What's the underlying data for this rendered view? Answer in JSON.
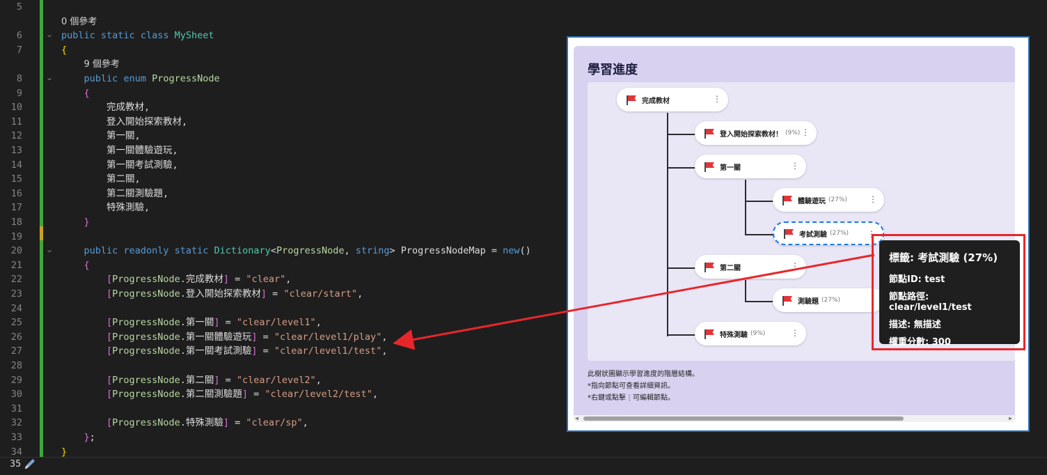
{
  "editor": {
    "lines": [
      {
        "n": "5",
        "parts": []
      },
      {
        "n": "",
        "parts": [
          {
            "c": "ref",
            "t": "0 個參考"
          }
        ]
      },
      {
        "n": "6",
        "fold": "v",
        "parts": [
          {
            "c": "kw",
            "t": "public"
          },
          {
            "c": "pl",
            "t": " "
          },
          {
            "c": "kw",
            "t": "static"
          },
          {
            "c": "pl",
            "t": " "
          },
          {
            "c": "kw",
            "t": "class"
          },
          {
            "c": "pl",
            "t": " "
          },
          {
            "c": "ty",
            "t": "MySheet"
          }
        ]
      },
      {
        "n": "7",
        "parts": [
          {
            "c": "bk",
            "t": "{"
          }
        ]
      },
      {
        "n": "",
        "parts": [
          {
            "c": "ws",
            "t": "    "
          },
          {
            "c": "ref",
            "t": "9 個參考"
          }
        ]
      },
      {
        "n": "8",
        "fold": "v",
        "parts": [
          {
            "c": "ws",
            "t": "    "
          },
          {
            "c": "kw",
            "t": "public"
          },
          {
            "c": "pl",
            "t": " "
          },
          {
            "c": "kw",
            "t": "enum"
          },
          {
            "c": "pl",
            "t": " "
          },
          {
            "c": "en",
            "t": "ProgressNode"
          }
        ]
      },
      {
        "n": "9",
        "parts": [
          {
            "c": "ws",
            "t": "    "
          },
          {
            "c": "pu",
            "t": "{"
          }
        ]
      },
      {
        "n": "10",
        "parts": [
          {
            "c": "ws",
            "t": "        "
          },
          {
            "c": "pl",
            "t": "完成教材,"
          }
        ]
      },
      {
        "n": "11",
        "parts": [
          {
            "c": "ws",
            "t": "        "
          },
          {
            "c": "pl",
            "t": "登入開始探索教材,"
          }
        ]
      },
      {
        "n": "12",
        "parts": [
          {
            "c": "ws",
            "t": "        "
          },
          {
            "c": "pl",
            "t": "第一關,"
          }
        ]
      },
      {
        "n": "13",
        "parts": [
          {
            "c": "ws",
            "t": "        "
          },
          {
            "c": "pl",
            "t": "第一關體驗遊玩,"
          }
        ]
      },
      {
        "n": "14",
        "parts": [
          {
            "c": "ws",
            "t": "        "
          },
          {
            "c": "pl",
            "t": "第一關考試測驗,"
          }
        ]
      },
      {
        "n": "15",
        "parts": [
          {
            "c": "ws",
            "t": "        "
          },
          {
            "c": "pl",
            "t": "第二關,"
          }
        ]
      },
      {
        "n": "16",
        "parts": [
          {
            "c": "ws",
            "t": "        "
          },
          {
            "c": "pl",
            "t": "第二關測驗題,"
          }
        ]
      },
      {
        "n": "17",
        "parts": [
          {
            "c": "ws",
            "t": "        "
          },
          {
            "c": "pl",
            "t": "特殊測驗,"
          }
        ]
      },
      {
        "n": "18",
        "parts": [
          {
            "c": "ws",
            "t": "    "
          },
          {
            "c": "pu",
            "t": "}"
          }
        ]
      },
      {
        "n": "19",
        "parts": []
      },
      {
        "n": "20",
        "fold": "v",
        "parts": [
          {
            "c": "ws",
            "t": "    "
          },
          {
            "c": "kw",
            "t": "public"
          },
          {
            "c": "pl",
            "t": " "
          },
          {
            "c": "kw",
            "t": "readonly"
          },
          {
            "c": "pl",
            "t": " "
          },
          {
            "c": "kw",
            "t": "static"
          },
          {
            "c": "pl",
            "t": " "
          },
          {
            "c": "ty",
            "t": "Dictionary"
          },
          {
            "c": "pl",
            "t": "<"
          },
          {
            "c": "en",
            "t": "ProgressNode"
          },
          {
            "c": "pl",
            "t": ", "
          },
          {
            "c": "kw",
            "t": "string"
          },
          {
            "c": "pl",
            "t": "> ProgressNodeMap = "
          },
          {
            "c": "kw",
            "t": "new"
          },
          {
            "c": "pl",
            "t": "()"
          }
        ]
      },
      {
        "n": "21",
        "parts": [
          {
            "c": "ws",
            "t": "    "
          },
          {
            "c": "pu",
            "t": "{"
          }
        ]
      },
      {
        "n": "22",
        "parts": [
          {
            "c": "ws",
            "t": "        "
          },
          {
            "c": "pu",
            "t": "["
          },
          {
            "c": "en",
            "t": "ProgressNode"
          },
          {
            "c": "pl",
            "t": ".完成教材"
          },
          {
            "c": "pu",
            "t": "]"
          },
          {
            "c": "pl",
            "t": " = "
          },
          {
            "c": "st",
            "t": "\"clear\""
          },
          {
            "c": "pl",
            "t": ","
          }
        ]
      },
      {
        "n": "23",
        "parts": [
          {
            "c": "ws",
            "t": "        "
          },
          {
            "c": "pu",
            "t": "["
          },
          {
            "c": "en",
            "t": "ProgressNode"
          },
          {
            "c": "pl",
            "t": ".登入開始探索教材"
          },
          {
            "c": "pu",
            "t": "]"
          },
          {
            "c": "pl",
            "t": " = "
          },
          {
            "c": "st",
            "t": "\"clear/start\""
          },
          {
            "c": "pl",
            "t": ","
          }
        ]
      },
      {
        "n": "24",
        "parts": []
      },
      {
        "n": "25",
        "parts": [
          {
            "c": "ws",
            "t": "        "
          },
          {
            "c": "pu",
            "t": "["
          },
          {
            "c": "en",
            "t": "ProgressNode"
          },
          {
            "c": "pl",
            "t": ".第一關"
          },
          {
            "c": "pu",
            "t": "]"
          },
          {
            "c": "pl",
            "t": " = "
          },
          {
            "c": "st",
            "t": "\"clear/level1\""
          },
          {
            "c": "pl",
            "t": ","
          }
        ]
      },
      {
        "n": "26",
        "parts": [
          {
            "c": "ws",
            "t": "        "
          },
          {
            "c": "pu",
            "t": "["
          },
          {
            "c": "en",
            "t": "ProgressNode"
          },
          {
            "c": "pl",
            "t": ".第一關體驗遊玩"
          },
          {
            "c": "pu",
            "t": "]"
          },
          {
            "c": "pl",
            "t": " = "
          },
          {
            "c": "st",
            "t": "\"clear/level1/play\""
          },
          {
            "c": "pl",
            "t": ","
          }
        ]
      },
      {
        "n": "27",
        "parts": [
          {
            "c": "ws",
            "t": "        "
          },
          {
            "c": "pu",
            "t": "["
          },
          {
            "c": "en",
            "t": "ProgressNode"
          },
          {
            "c": "pl",
            "t": ".第一關考試測驗"
          },
          {
            "c": "pu",
            "t": "]"
          },
          {
            "c": "pl",
            "t": " = "
          },
          {
            "c": "st",
            "t": "\"clear/level1/test\""
          },
          {
            "c": "pl",
            "t": ","
          }
        ]
      },
      {
        "n": "28",
        "parts": []
      },
      {
        "n": "29",
        "parts": [
          {
            "c": "ws",
            "t": "        "
          },
          {
            "c": "pu",
            "t": "["
          },
          {
            "c": "en",
            "t": "ProgressNode"
          },
          {
            "c": "pl",
            "t": ".第二關"
          },
          {
            "c": "pu",
            "t": "]"
          },
          {
            "c": "pl",
            "t": " = "
          },
          {
            "c": "st",
            "t": "\"clear/level2\""
          },
          {
            "c": "pl",
            "t": ","
          }
        ]
      },
      {
        "n": "30",
        "parts": [
          {
            "c": "ws",
            "t": "        "
          },
          {
            "c": "pu",
            "t": "["
          },
          {
            "c": "en",
            "t": "ProgressNode"
          },
          {
            "c": "pl",
            "t": ".第二關測驗題"
          },
          {
            "c": "pu",
            "t": "]"
          },
          {
            "c": "pl",
            "t": " = "
          },
          {
            "c": "st",
            "t": "\"clear/level2/test\""
          },
          {
            "c": "pl",
            "t": ","
          }
        ]
      },
      {
        "n": "31",
        "parts": []
      },
      {
        "n": "32",
        "parts": [
          {
            "c": "ws",
            "t": "        "
          },
          {
            "c": "pu",
            "t": "["
          },
          {
            "c": "en",
            "t": "ProgressNode"
          },
          {
            "c": "pl",
            "t": ".特殊測驗"
          },
          {
            "c": "pu",
            "t": "]"
          },
          {
            "c": "pl",
            "t": " = "
          },
          {
            "c": "st",
            "t": "\"clear/sp\""
          },
          {
            "c": "pl",
            "t": ","
          }
        ]
      },
      {
        "n": "33",
        "parts": [
          {
            "c": "ws",
            "t": "    "
          },
          {
            "c": "pu",
            "t": "}"
          },
          {
            "c": "pl",
            "t": ";"
          }
        ]
      },
      {
        "n": "34",
        "parts": [
          {
            "c": "bk",
            "t": "}"
          }
        ]
      }
    ],
    "last_line_number": "35"
  },
  "panel": {
    "title": "學習進度",
    "nodes": [
      {
        "label": "完成教材",
        "pct": ""
      },
      {
        "label": "登入開始探索教材！",
        "pct": "(9%)"
      },
      {
        "label": "第一關",
        "pct": ""
      },
      {
        "label": "體驗遊玩",
        "pct": "(27%)"
      },
      {
        "label": "考試測驗",
        "pct": "(27%)"
      },
      {
        "label": "第二關",
        "pct": ""
      },
      {
        "label": "測驗題",
        "pct": "(27%)"
      },
      {
        "label": "特殊測驗",
        "pct": "(9%)"
      }
    ],
    "kebab": "⋮",
    "notes": [
      "此樹狀圖顯示學習進度的階層結構。",
      "*指向節點可查看詳細資訊。",
      "*右鍵或點擊⋮可編輯節點。"
    ],
    "scroll_left": "◀",
    "scroll_right": "▶"
  },
  "tooltip": {
    "title": "標籤: 考試測驗 (27%)",
    "rows": [
      "節點ID: test",
      "節點路徑: clear/level1/test",
      "描述: 無描述",
      "權重分數: 300"
    ]
  },
  "colors": {
    "accent_red": "#e8262a",
    "flag_red": "#e0353b",
    "selected_blue": "#1f7ae0"
  }
}
